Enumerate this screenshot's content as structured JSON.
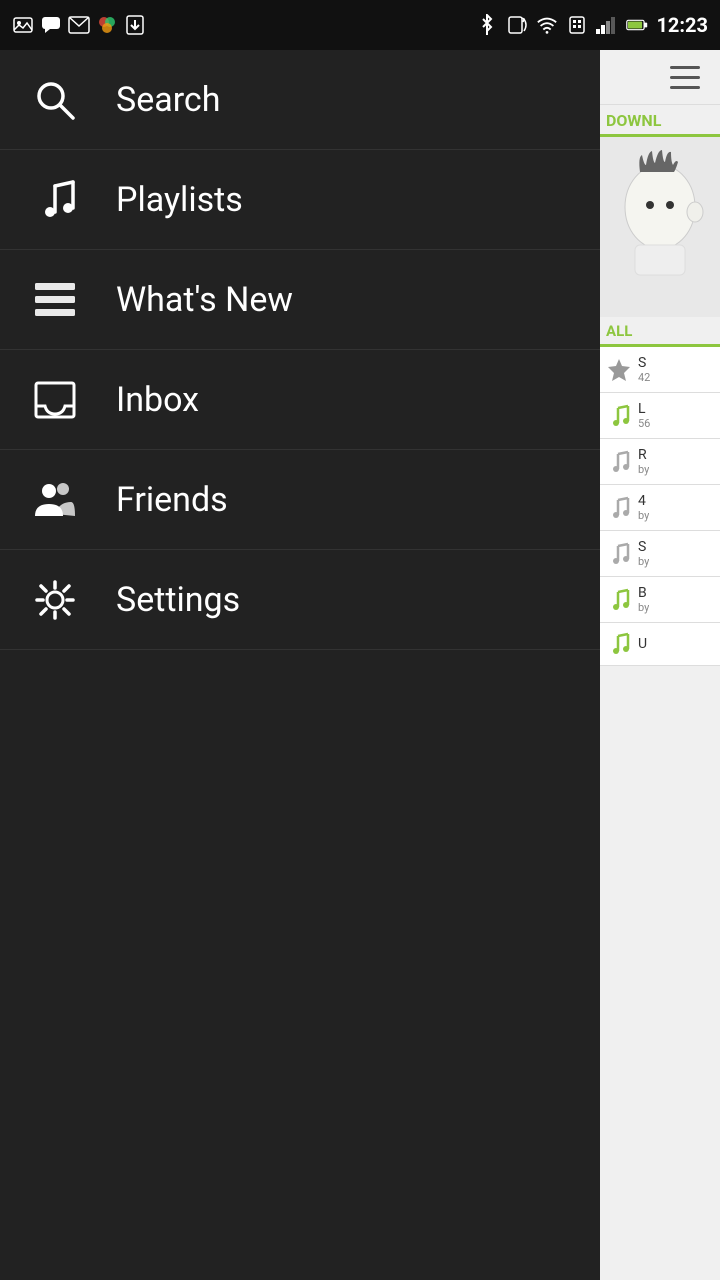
{
  "statusBar": {
    "time": "12:23",
    "icons": [
      "gallery",
      "talk",
      "gmail",
      "colorful-app",
      "download-app",
      "bluetooth",
      "screen-rotate",
      "wifi",
      "sim",
      "signal",
      "battery"
    ]
  },
  "drawer": {
    "items": [
      {
        "id": "search",
        "label": "Search",
        "icon": "search"
      },
      {
        "id": "playlists",
        "label": "Playlists",
        "icon": "music-note"
      },
      {
        "id": "whats-new",
        "label": "What's New",
        "icon": "list-view"
      },
      {
        "id": "inbox",
        "label": "Inbox",
        "icon": "inbox"
      },
      {
        "id": "friends",
        "label": "Friends",
        "icon": "people"
      },
      {
        "id": "settings",
        "label": "Settings",
        "icon": "gear"
      }
    ]
  },
  "rightPanel": {
    "tabLabel": "DOWNL",
    "allTab": "ALL",
    "listItems": [
      {
        "title": "S",
        "sub": "42",
        "iconColor": "gray",
        "hasStar": true
      },
      {
        "title": "L",
        "sub": "56",
        "iconColor": "#8dc63f",
        "hasStar": false
      },
      {
        "title": "R",
        "sub": "by",
        "iconColor": "gray",
        "hasStar": false
      },
      {
        "title": "4",
        "sub": "by",
        "iconColor": "gray",
        "hasStar": false
      },
      {
        "title": "S",
        "sub": "by",
        "iconColor": "gray",
        "hasStar": false
      },
      {
        "title": "B",
        "sub": "by",
        "iconColor": "#8dc63f",
        "hasStar": false
      },
      {
        "title": "U",
        "sub": "",
        "iconColor": "#8dc63f",
        "hasStar": false
      }
    ]
  }
}
